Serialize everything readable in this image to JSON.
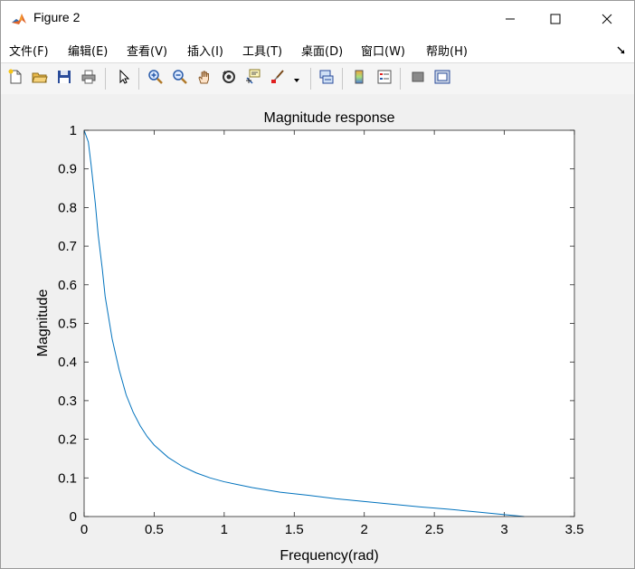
{
  "window": {
    "title": "Figure 2",
    "icon": "matlab-logo-icon",
    "controls": {
      "minimize": "minimize-icon",
      "maximize": "maximize-icon",
      "close": "close-icon"
    }
  },
  "menu": {
    "items": [
      "文件(F)",
      "编辑(E)",
      "查看(V)",
      "插入(I)",
      "工具(T)",
      "桌面(D)",
      "窗口(W)",
      "帮助(H)"
    ],
    "dock_icon": "dock-arrow-icon"
  },
  "toolbar": {
    "buttons": [
      "new-figure-icon",
      "open-file-icon",
      "save-icon",
      "print-icon",
      "select-arrow-icon",
      "zoom-in-icon",
      "zoom-out-icon",
      "pan-hand-icon",
      "rotate-3d-icon",
      "data-cursor-icon",
      "brush-icon",
      "brush-dropdown-icon",
      "link-plot-icon",
      "colorbar-icon",
      "legend-icon",
      "hide-plot-tools-icon",
      "show-plot-tools-icon"
    ]
  },
  "colors": {
    "line": "#0072BD",
    "axes_background": "#ffffff",
    "figure_background": "#f0f0f0"
  },
  "chart_data": {
    "type": "line",
    "title": "Magnitude response",
    "xlabel": "Frequency(rad)",
    "ylabel": "Magnitude",
    "xlim": [
      0,
      3.5
    ],
    "ylim": [
      0,
      1
    ],
    "xticks": [
      0,
      0.5,
      1,
      1.5,
      2,
      2.5,
      3,
      3.5
    ],
    "xtick_labels": [
      "0",
      "0.5",
      "1",
      "1.5",
      "2",
      "2.5",
      "3",
      "3.5"
    ],
    "yticks": [
      0,
      0.1,
      0.2,
      0.3,
      0.4,
      0.5,
      0.6,
      0.7,
      0.8,
      0.9,
      1
    ],
    "ytick_labels": [
      "0",
      "0.1",
      "0.2",
      "0.3",
      "0.4",
      "0.5",
      "0.6",
      "0.7",
      "0.8",
      "0.9",
      "1"
    ],
    "grid": false,
    "series": [
      {
        "x": [
          0,
          0.03,
          0.05,
          0.08,
          0.1,
          0.13,
          0.15,
          0.2,
          0.25,
          0.3,
          0.35,
          0.4,
          0.45,
          0.5,
          0.6,
          0.7,
          0.8,
          0.9,
          1.0,
          1.2,
          1.4,
          1.6,
          1.8,
          2.0,
          2.2,
          2.4,
          2.6,
          2.8,
          3.0,
          3.1416
        ],
        "y": [
          1.0,
          0.97,
          0.91,
          0.81,
          0.73,
          0.64,
          0.57,
          0.46,
          0.38,
          0.315,
          0.27,
          0.235,
          0.207,
          0.185,
          0.153,
          0.13,
          0.113,
          0.1,
          0.09,
          0.075,
          0.063,
          0.055,
          0.046,
          0.039,
          0.032,
          0.025,
          0.019,
          0.012,
          0.005,
          0.0
        ]
      }
    ]
  }
}
